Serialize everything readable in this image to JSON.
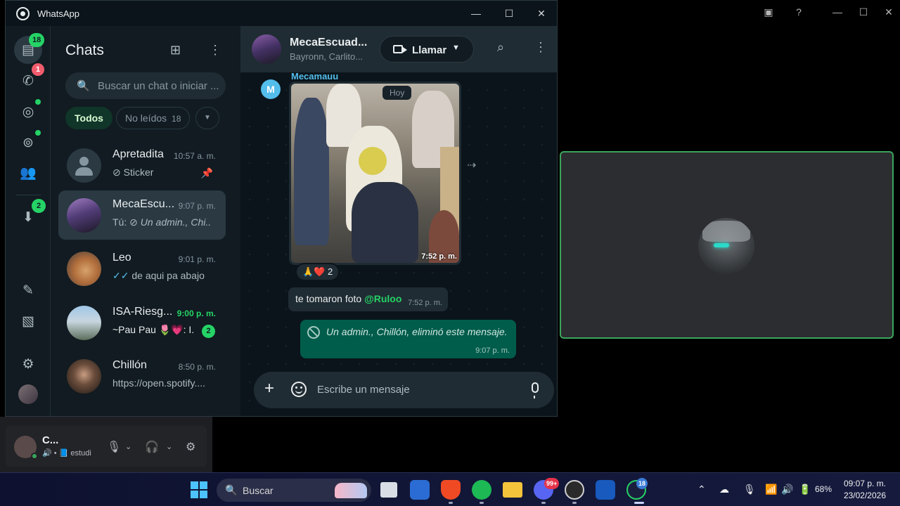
{
  "whatsapp": {
    "title": "WhatsApp",
    "rail": {
      "chats_badge": "18",
      "calls_badge": "1",
      "archived_badge": "2"
    },
    "list": {
      "title": "Chats",
      "search_placeholder": "Buscar un chat o iniciar ...",
      "filters": [
        {
          "label": "Todos"
        },
        {
          "label": "No leídos"
        }
      ],
      "unread_count": "18",
      "chats": [
        {
          "name": "Apretadita",
          "time": "10:57 a. m.",
          "preview": "Sticker",
          "preview_icon": "sticker-icon"
        },
        {
          "name": "MecaEscu...",
          "time": "9:07 p. m.",
          "preview_prefix": "Tú:",
          "preview": "Un admin., Chi...",
          "preview_icon": "deleted-icon"
        },
        {
          "name": "Leo",
          "time": "9:01 p. m.",
          "preview": "de aqui pa abajo",
          "preview_icon": "double-check-icon"
        },
        {
          "name": "ISA-Riesg...",
          "time": "9:00 p. m.",
          "preview": "~Pau Pau 🌷💗: I.",
          "badge": "2"
        },
        {
          "name": "Chillón",
          "time": "8:50 p. m.",
          "preview": "https://open.spotify...."
        }
      ]
    },
    "conversation": {
      "name": "MecaEscuad...",
      "members": "Bayronn, Carlito...",
      "call_label": "Llamar",
      "sender": "Mecamauu",
      "sender_initial": "M",
      "day_label": "Hoy",
      "photo_time": "7:52 p. m.",
      "reactions": "🙏❤️ 2",
      "text_message": "te tomaron foto ",
      "mention": "@Ruloo",
      "text_time": "7:52 p. m.",
      "deleted_message": "Un admin., Chillón, eliminó este mensaje.",
      "deleted_time": "9:07 p. m.",
      "composer_placeholder": "Escribe un mensaje"
    }
  },
  "discord": {
    "user_name": "C...",
    "user_status": "estudi"
  },
  "taskbar": {
    "search_label": "Buscar",
    "discord_badge": "99+",
    "whatsapp_badge": "18",
    "battery": "68%",
    "time": "09:07 p. m.",
    "date": "23/02/2026"
  },
  "colors": {
    "accent": "#25d366",
    "outgoing_bubble": "#005c4b",
    "incoming_bubble": "#202c33",
    "call_border": "#3ba55c"
  }
}
